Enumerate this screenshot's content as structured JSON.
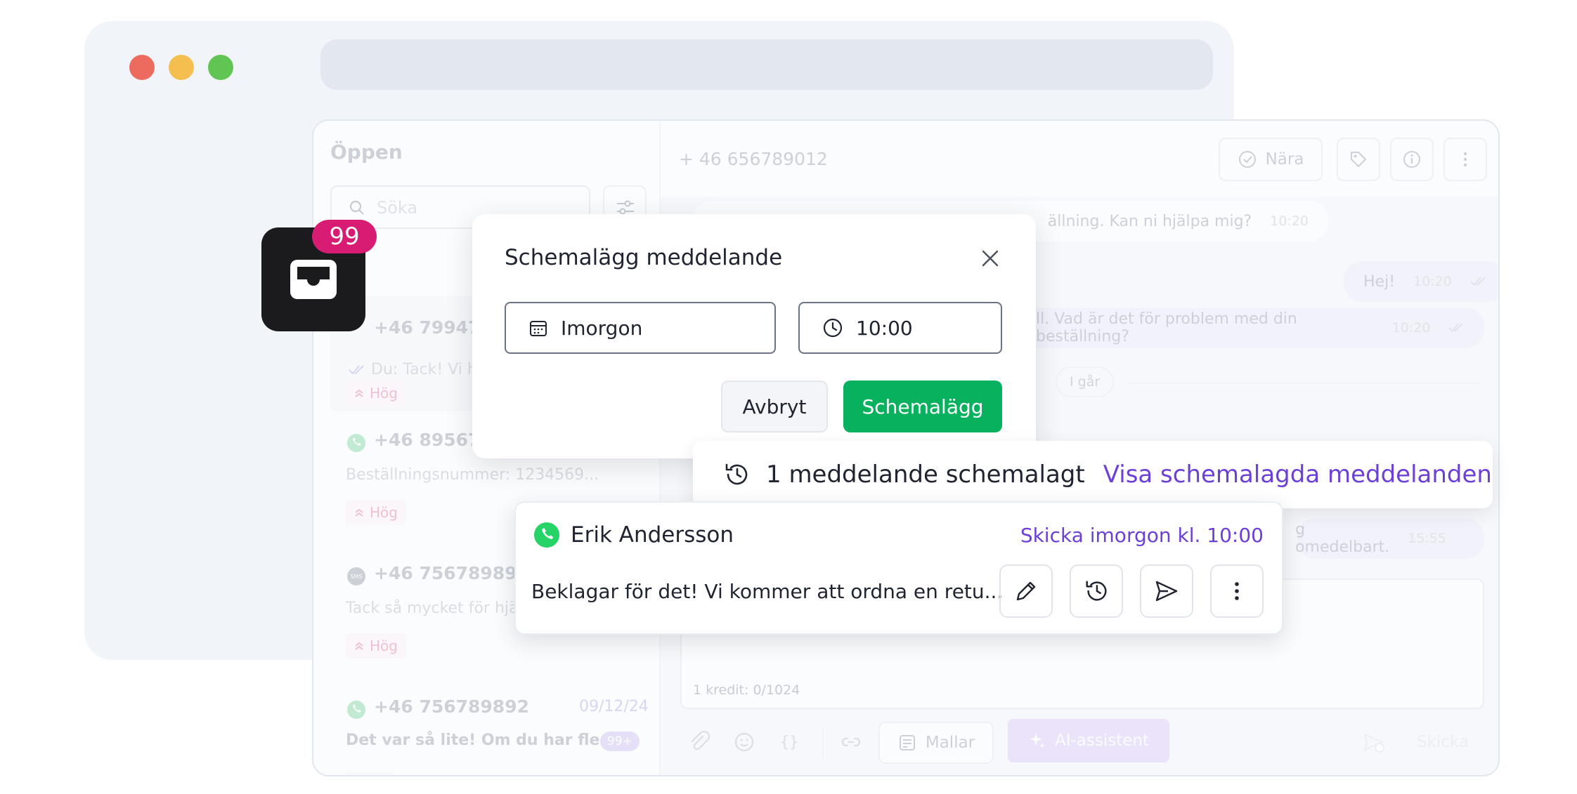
{
  "sidebar": {
    "title": "Öppen",
    "search_placeholder": "Söka",
    "conversations": [
      {
        "phone": "+46 799478",
        "preview": "Du: Tack! Vi ha",
        "tag": "Hög"
      },
      {
        "phone": "+46 895678",
        "preview": "Beställningsnummer: 1234569...",
        "tag": "Hög"
      },
      {
        "phone": "+46 7567898982",
        "preview": "Tack så mycket för hjäl",
        "tag": "Hög"
      },
      {
        "phone": "+46 756789892",
        "date": "09/12/24",
        "preview": "Det var så lite! Om du har fle...",
        "count": "99+"
      }
    ]
  },
  "badge": {
    "count": "99"
  },
  "header": {
    "phone": "+ 46 656789012",
    "close_label": "Nära"
  },
  "messages": [
    {
      "text": "ällning. Kan ni hjälpa mig?",
      "time": "10:20"
    },
    {
      "text": "Hej!",
      "time": "10:20"
    },
    {
      "text": "ll. Vad är det för problem med din beställning?",
      "time": "10:20"
    },
    {
      "text": "g omedelbart.",
      "time": "15:55"
    }
  ],
  "divider": "I går",
  "composer": {
    "credit": "1 kredit: 0/1024",
    "templates_label": "Mallar",
    "ai_label": "AI-assistent",
    "send_label": "Skicka"
  },
  "modal": {
    "title": "Schemalägg meddelande",
    "date_value": "Imorgon",
    "time_value": "10:00",
    "cancel_label": "Avbryt",
    "schedule_label": "Schemalägg"
  },
  "banner": {
    "text": "1 meddelande schemalagt",
    "link": "Visa schemalagda meddelanden"
  },
  "scheduled_card": {
    "name": "Erik Andersson",
    "when": "Skicka imorgon kl. 10:00",
    "message": "Beklagar för det! Vi kommer att ordna en retu..."
  },
  "colors": {
    "accent": "#6c3fd6",
    "primary_green": "#08b15e",
    "badge": "#d81b73",
    "whatsapp": "#25d366"
  }
}
